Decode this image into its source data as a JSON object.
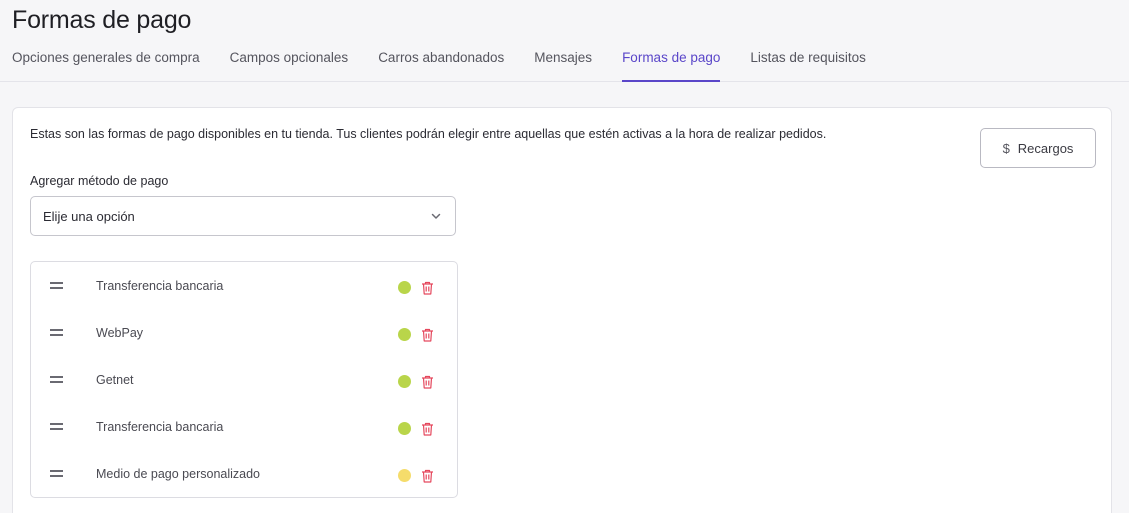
{
  "page": {
    "title": "Formas de pago"
  },
  "tabs": [
    {
      "label": "Opciones generales de compra",
      "active": false
    },
    {
      "label": "Campos opcionales",
      "active": false
    },
    {
      "label": "Carros abandonados",
      "active": false
    },
    {
      "label": "Mensajes",
      "active": false
    },
    {
      "label": "Formas de pago",
      "active": true
    },
    {
      "label": "Listas de requisitos",
      "active": false
    }
  ],
  "card": {
    "description": "Estas son las formas de pago disponibles en tu tienda. Tus clientes podrán elegir entre aquellas que estén activas a la hora de realizar pedidos.",
    "surcharge_button": {
      "icon": "dollar-icon",
      "label": "Recargos"
    },
    "add_method": {
      "label": "Agregar método de pago",
      "selected_value": "Elije una opción"
    },
    "methods": [
      {
        "name": "Transferencia bancaria",
        "status_color": "#b9d54a"
      },
      {
        "name": "WebPay",
        "status_color": "#b9d54a"
      },
      {
        "name": "Getnet",
        "status_color": "#b9d54a"
      },
      {
        "name": "Transferencia bancaria",
        "status_color": "#b9d54a"
      },
      {
        "name": "Medio de pago personalizado",
        "status_color": "#f5dc6b"
      }
    ]
  },
  "colors": {
    "accent": "#5a46c9",
    "delete_icon": "#e5485d",
    "status_active": "#b9d54a",
    "status_pending": "#f5dc6b"
  }
}
